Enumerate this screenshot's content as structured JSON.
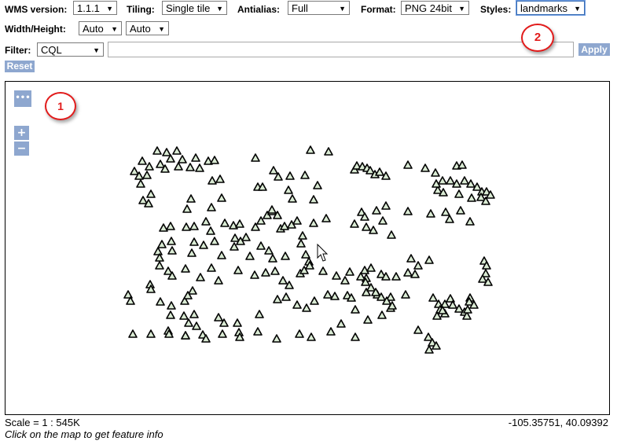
{
  "toolbar": {
    "wms_version": {
      "label": "WMS version:",
      "value": "1.1.1"
    },
    "tiling": {
      "label": "Tiling:",
      "value": "Single tile"
    },
    "antialias": {
      "label": "Antialias:",
      "value": "Full"
    },
    "format": {
      "label": "Format:",
      "value": "PNG 24bit"
    },
    "styles": {
      "label": "Styles:",
      "value": "landmarks"
    },
    "width_height": {
      "label": "Width/Height:",
      "width_value": "Auto",
      "height_value": "Auto"
    },
    "filter": {
      "label": "Filter:",
      "type_value": "CQL",
      "text_value": ""
    },
    "apply_label": "Apply",
    "reset_label": "Reset"
  },
  "map": {
    "more_label": "•••",
    "zoom_in_label": "+",
    "zoom_out_label": "−"
  },
  "callouts": {
    "one": "1",
    "two": "2"
  },
  "footer": {
    "scale": "Scale = 1 : 545K",
    "coords": "-105.35751, 40.09392",
    "hint": "Click on the map to get feature info"
  },
  "colors": {
    "accent": "#8ea7cf",
    "callout": "#e21b1b",
    "marker_fill": "#d9ead3"
  },
  "icons": {
    "marker": "triangle-marker-icon",
    "cursor": "mouse-pointer-icon"
  }
}
